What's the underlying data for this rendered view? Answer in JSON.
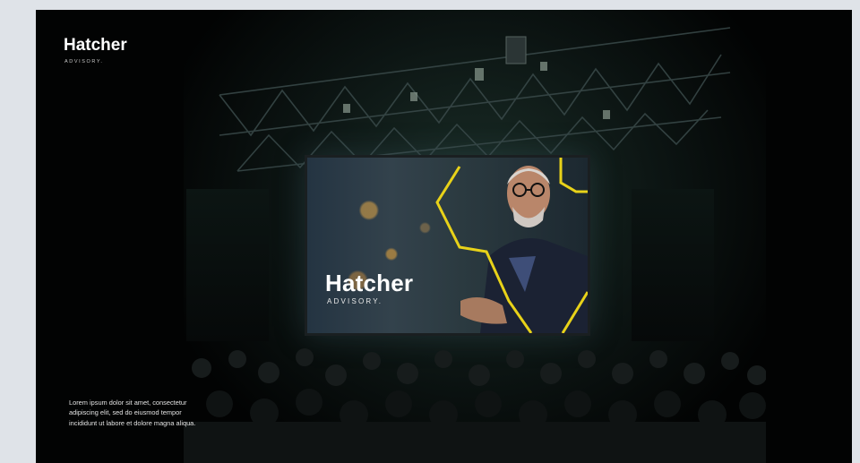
{
  "brand": {
    "name": "Hatcher",
    "tagline": "ADVISORY."
  },
  "screen": {
    "name": "Hatcher",
    "tagline": "ADVISORY."
  },
  "caption": "Lorem ipsum dolor sit amet, consectetur adipiscing elit, sed do eiusmod tempor incididunt ut labore et dolore magna aliqua.",
  "colors": {
    "background": "#dfe3e8",
    "frame": "#020303",
    "accent": "#e8d219"
  }
}
